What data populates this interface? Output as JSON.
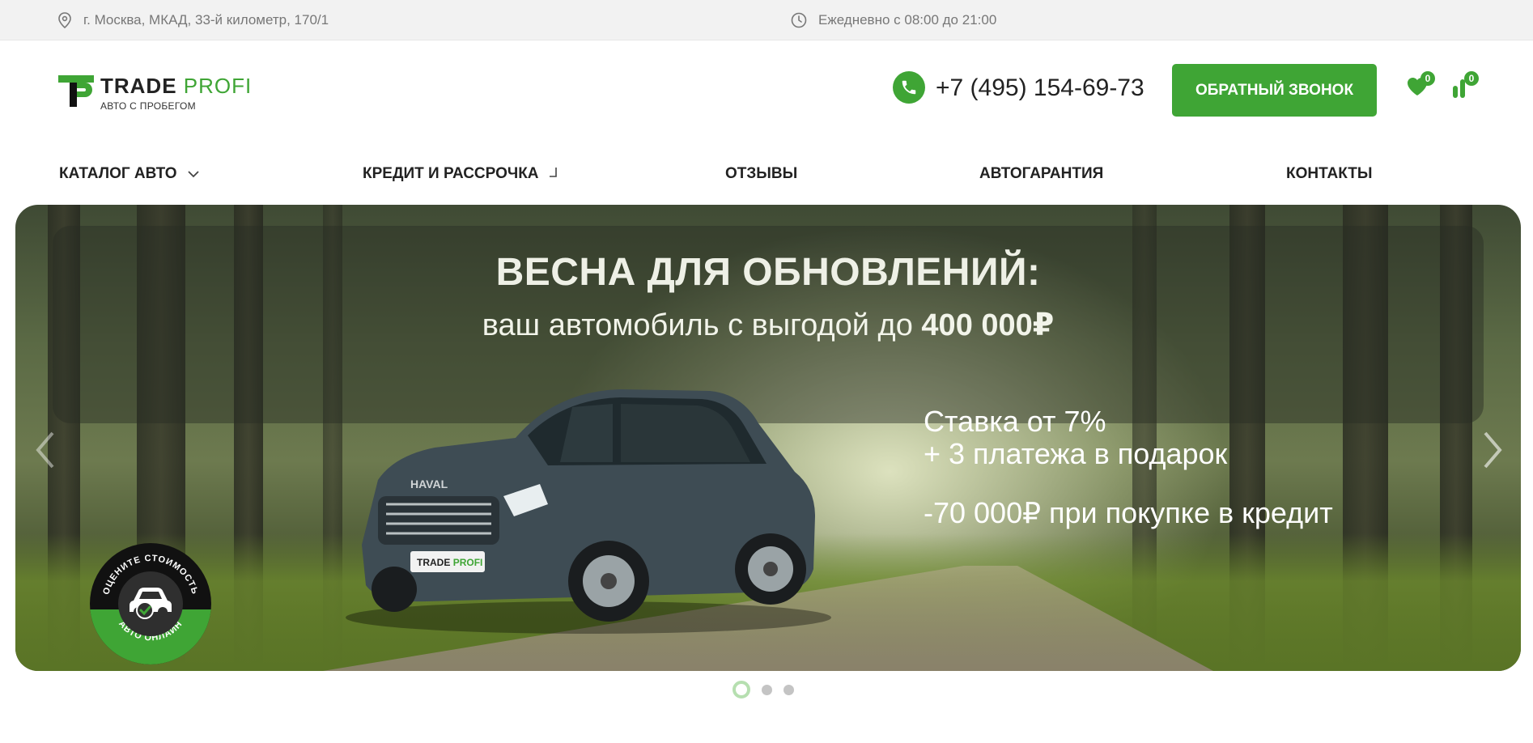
{
  "topbar": {
    "address": "г. Москва, МКАД, 33-й километр, 170/1",
    "hours": "Ежедневно с 08:00 до 21:00"
  },
  "header": {
    "logo_word1": "TRADE",
    "logo_word2": "PROFI",
    "logo_tagline": "АВТО С ПРОБЕГОМ",
    "phone": "+7 (495) 154-69-73",
    "callback_label": "ОБРАТНЫЙ ЗВОНОК",
    "favorites_count": "0",
    "compare_count": "0"
  },
  "nav": {
    "items": [
      {
        "label": "КАТАЛОГ АВТО"
      },
      {
        "label": "КРЕДИТ И РАССРОЧКА"
      },
      {
        "label": "ОТЗЫВЫ"
      },
      {
        "label": "АВТОГАРАНТИЯ"
      },
      {
        "label": "КОНТАКТЫ"
      }
    ]
  },
  "banner": {
    "title": "ВЕСНА ДЛЯ ОБНОВЛЕНИЙ:",
    "subtitle_prefix": "ваш автомобиль с выгодой до",
    "subtitle_amount": "400 000₽",
    "rate_line1": "Ставка от 7%",
    "rate_line2": "+ 3 платежа в подарок",
    "credit_line": "-70 000₽ при покупке в кредит",
    "plate_text1": "TRADE",
    "plate_text2": "PROFI",
    "grille_brand": "HAVAL",
    "eval_top": "ОЦЕНИТЕ СТОИМОСТЬ",
    "eval_bottom": "АВТО ОНЛАЙН"
  },
  "carousel": {
    "total_slides": 3,
    "active_slide": 1
  },
  "colors": {
    "accent": "#3fa535",
    "topbar_bg": "#f2f2f2",
    "text": "#222222"
  }
}
